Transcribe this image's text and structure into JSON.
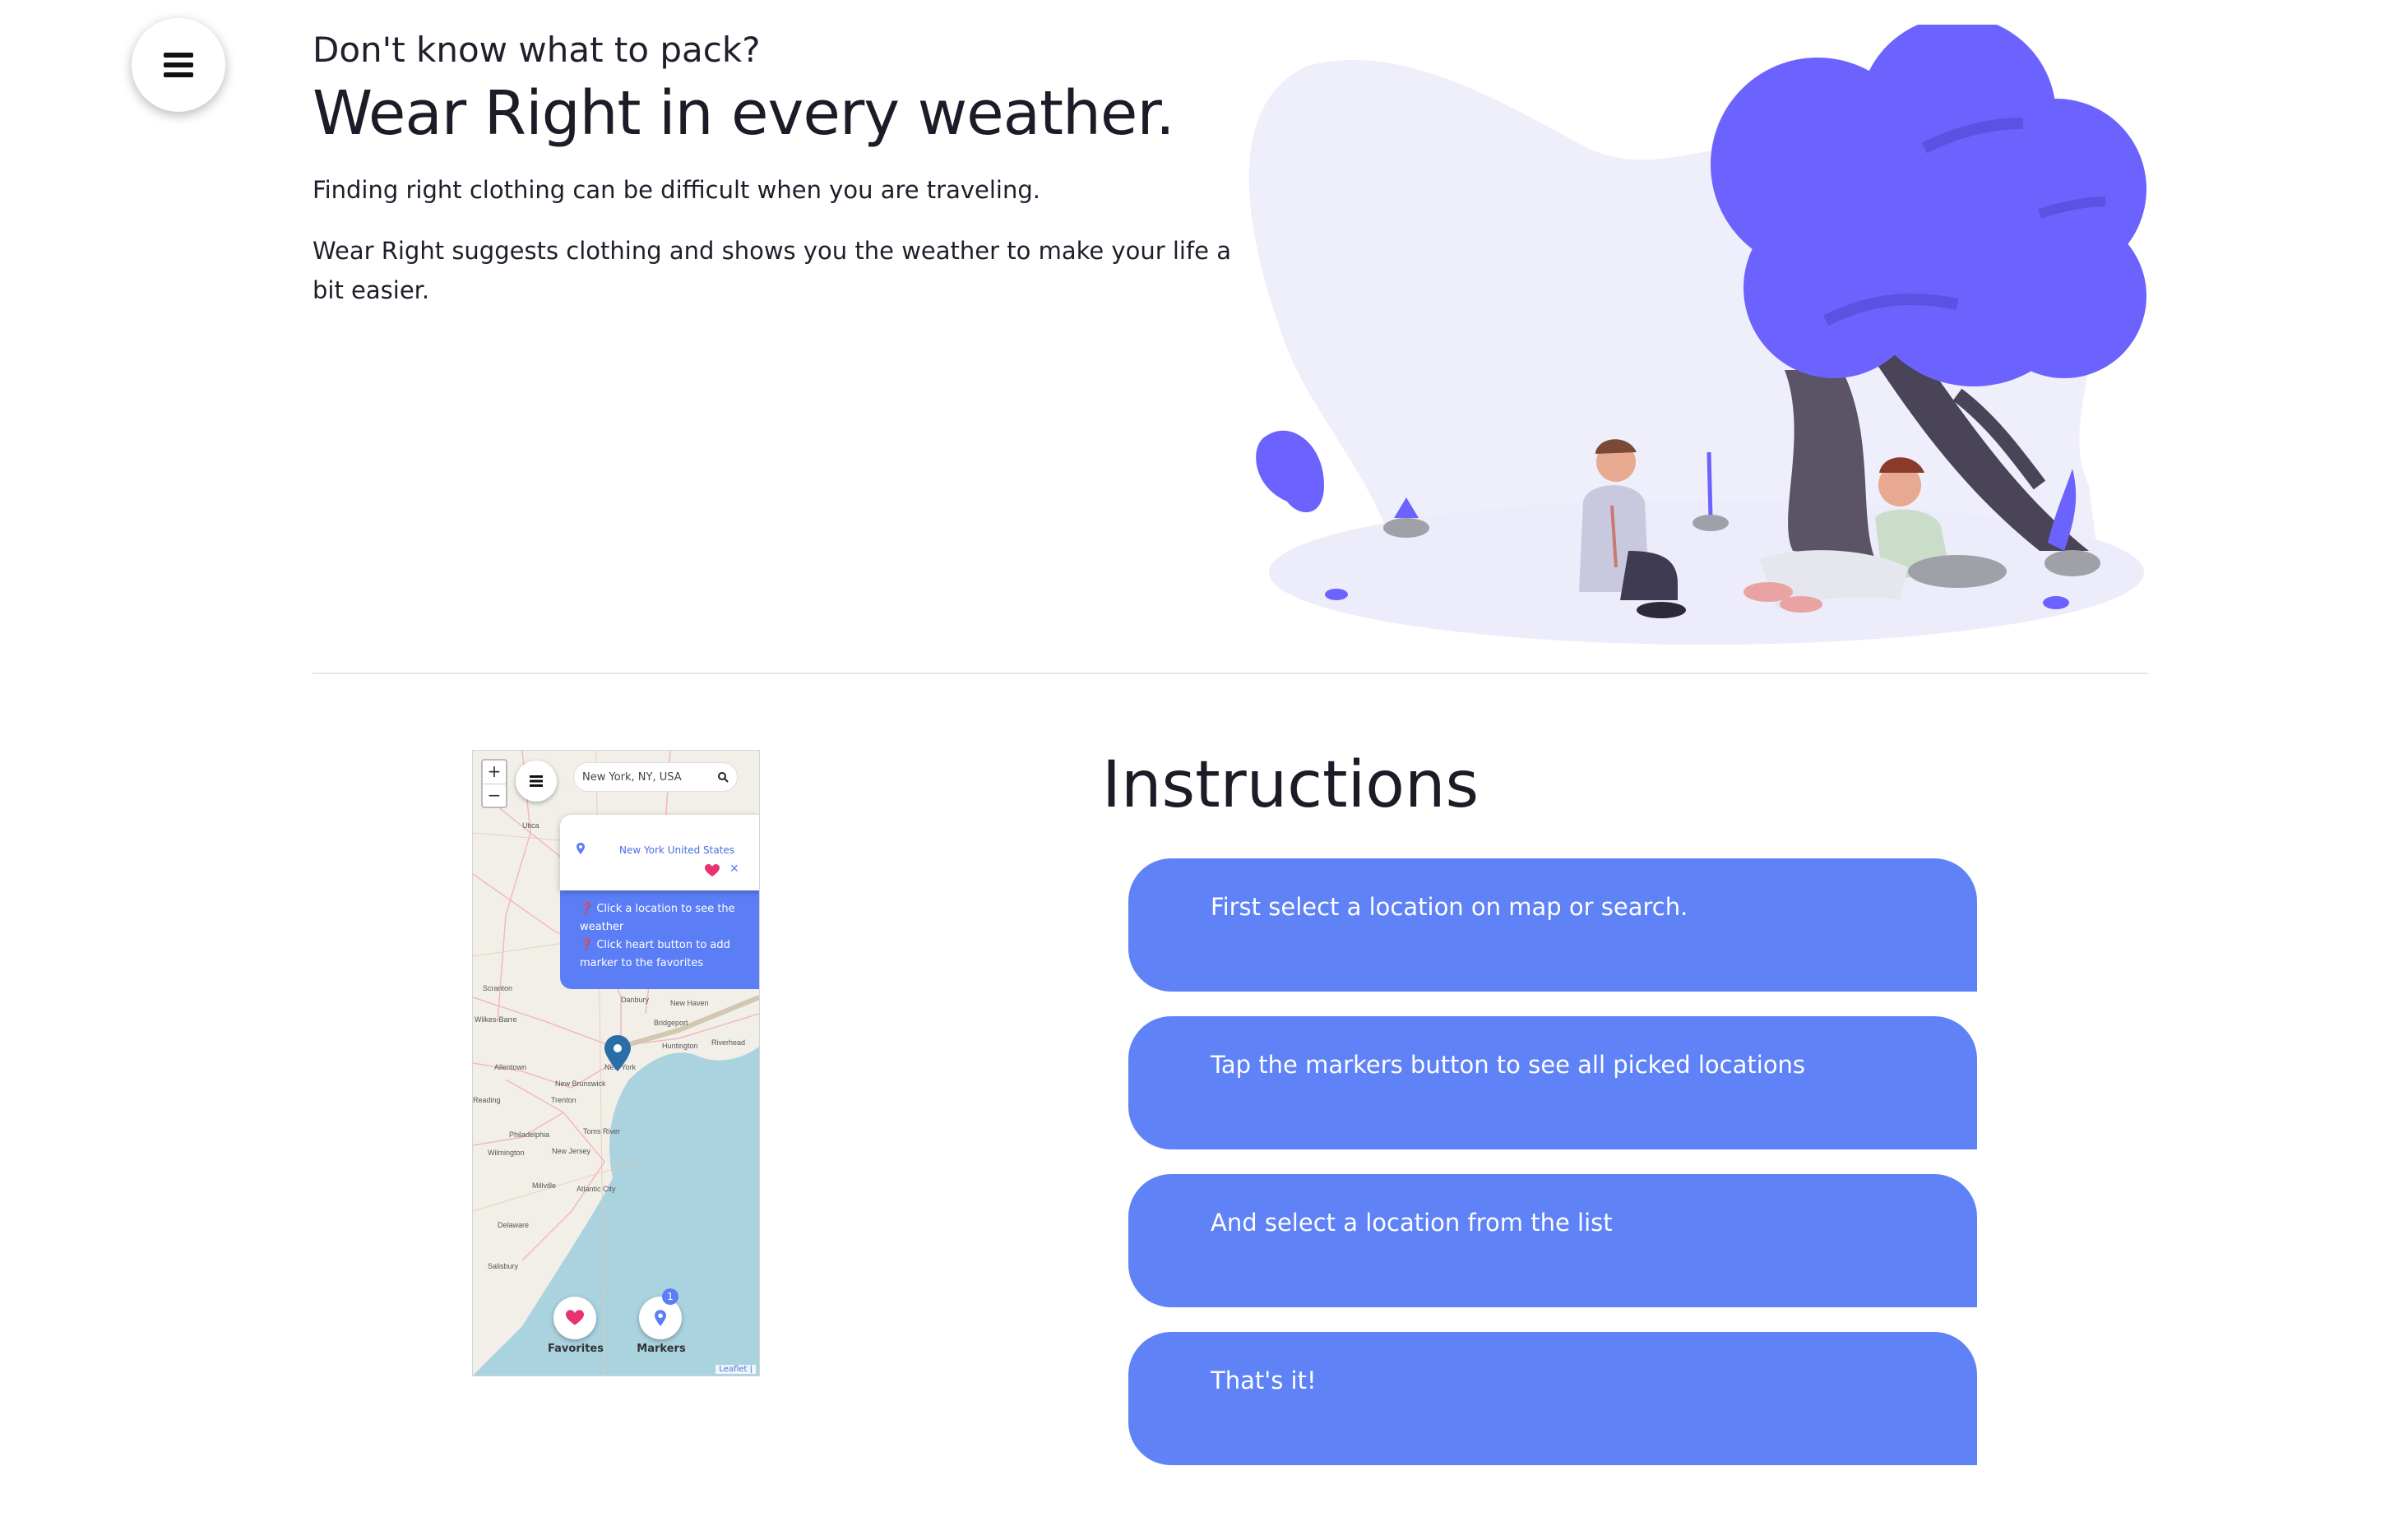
{
  "hero": {
    "subtitle": "Don't know what to pack?",
    "title": "Wear Right in every weather.",
    "paragraph1": "Finding right clothing can be difficult when you are traveling.",
    "paragraph2": "Wear Right suggests clothing and shows you the weather to make your life a bit easier."
  },
  "map_preview": {
    "zoom_in": "+",
    "zoom_out": "−",
    "search_value": "New York, NY, USA",
    "popup_location": "New York United States",
    "help_line1": "Click a location to see the weather",
    "help_line2": "Click heart button to add marker to the favorites",
    "favorites_label": "Favorites",
    "markers_label": "Markers",
    "markers_count": "1",
    "attribution": "Leaflet |",
    "city_labels": [
      "New York",
      "Utica",
      "Danbury",
      "New Haven",
      "Bridgeport",
      "Huntington",
      "Riverhead",
      "Allentown",
      "New Brunswick",
      "Trenton",
      "Philadelphia",
      "Toms River",
      "Wilmington",
      "New Jersey",
      "Millville",
      "Atlantic City",
      "Delaware",
      "Salisbury",
      "Scranton",
      "Wilkes-Barre",
      "Reading"
    ]
  },
  "instructions": {
    "title": "Instructions",
    "steps": [
      "First select a location on map or search.",
      "Tap the markers button to see all picked locations",
      "And select a location from the list",
      "That's it!"
    ]
  },
  "colors": {
    "accent": "#5f82f7",
    "illustration_purple": "#6c63ff",
    "background": "#ffffff"
  }
}
